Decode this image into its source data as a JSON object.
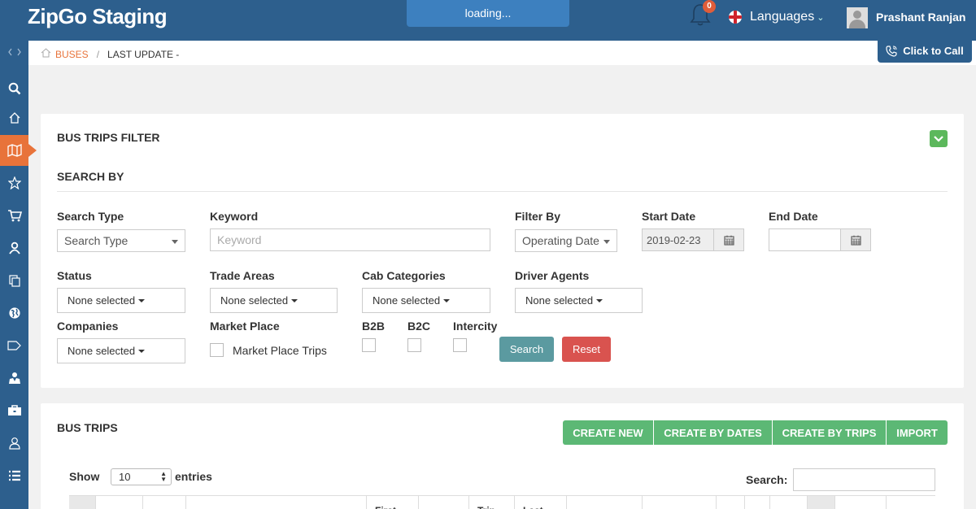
{
  "header": {
    "brand": "ZipGo Staging",
    "loading": "loading...",
    "notification_count": "0",
    "languages_label": "Languages",
    "user_name": "Prashant Ranjan",
    "click_to_call": "Click to Call"
  },
  "breadcrumb": {
    "link": "BUSES",
    "current": "LAST UPDATE -"
  },
  "filter": {
    "title": "BUS TRIPS FILTER",
    "section": "SEARCH BY",
    "search_type_label": "Search Type",
    "search_type_value": "Search Type",
    "keyword_label": "Keyword",
    "keyword_placeholder": "Keyword",
    "filter_by_label": "Filter By",
    "filter_by_value": "Operating Date",
    "start_date_label": "Start Date",
    "start_date_value": "2019-02-23",
    "end_date_label": "End Date",
    "end_date_value": "",
    "status_label": "Status",
    "status_value": "None selected",
    "trade_areas_label": "Trade Areas",
    "trade_areas_value": "None selected",
    "cab_categories_label": "Cab Categories",
    "cab_categories_value": "None selected",
    "driver_agents_label": "Driver Agents",
    "driver_agents_value": "None selected",
    "companies_label": "Companies",
    "companies_value": "None selected",
    "market_place_label": "Market Place",
    "market_place_option": "Market Place Trips",
    "b2b_label": "B2B",
    "b2c_label": "B2C",
    "intercity_label": "Intercity",
    "search_button": "Search",
    "reset_button": "Reset"
  },
  "trips": {
    "title": "BUS TRIPS",
    "actions": [
      "CREATE NEW",
      "CREATE BY DATES",
      "CREATE BY TRIPS",
      "IMPORT"
    ],
    "show_label": "Show",
    "page_size": "10",
    "entries_label": "entries",
    "search_label": "Search:",
    "columns": [
      "",
      "",
      "",
      "",
      "First",
      "",
      "Trip",
      "Last",
      "",
      "",
      "",
      "",
      "",
      "",
      "",
      ""
    ]
  },
  "colors": {
    "primary": "#2d5f8d",
    "accent": "#e8733a",
    "success": "#5cb875",
    "search_btn": "#5b9aa0",
    "reset_btn": "#d9534f"
  },
  "icons": {
    "sidebar": [
      "code-icon",
      "search-icon",
      "home-icon",
      "map-icon",
      "star-icon",
      "cart-icon",
      "user-icon",
      "copy-icon",
      "globe-icon",
      "tag-icon",
      "user-tie-icon",
      "briefcase-icon",
      "person-icon",
      "list-icon"
    ]
  }
}
